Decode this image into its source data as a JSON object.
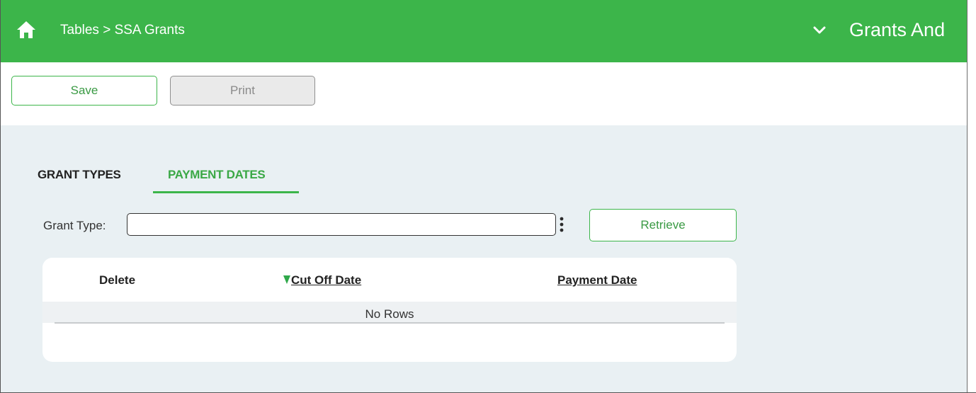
{
  "header": {
    "breadcrumb": "Tables > SSA Grants",
    "app_title": "Grants And",
    "icons": {
      "home": "home-icon",
      "menu": "chevron-down-icon"
    },
    "colors": {
      "brand": "#3cb54a",
      "header_text": "#ffffff"
    }
  },
  "toolbar": {
    "save_label": "Save",
    "print_label": "Print"
  },
  "tabs": [
    {
      "label": "GRANT TYPES",
      "active": false
    },
    {
      "label": "PAYMENT DATES",
      "active": true
    }
  ],
  "form": {
    "grant_type_label": "Grant Type:",
    "grant_type_value": "",
    "lookup_icon": "kebab-vertical-icon",
    "retrieve_label": "Retrieve"
  },
  "grid": {
    "columns": [
      {
        "label": "Delete",
        "sortable": false
      },
      {
        "label": "Cut Off Date",
        "sortable": true,
        "sorted": "descending",
        "sort_icon": "sort-down-icon"
      },
      {
        "label": "Payment Date",
        "sortable": true
      }
    ],
    "rows": [],
    "empty_text": "No Rows"
  }
}
